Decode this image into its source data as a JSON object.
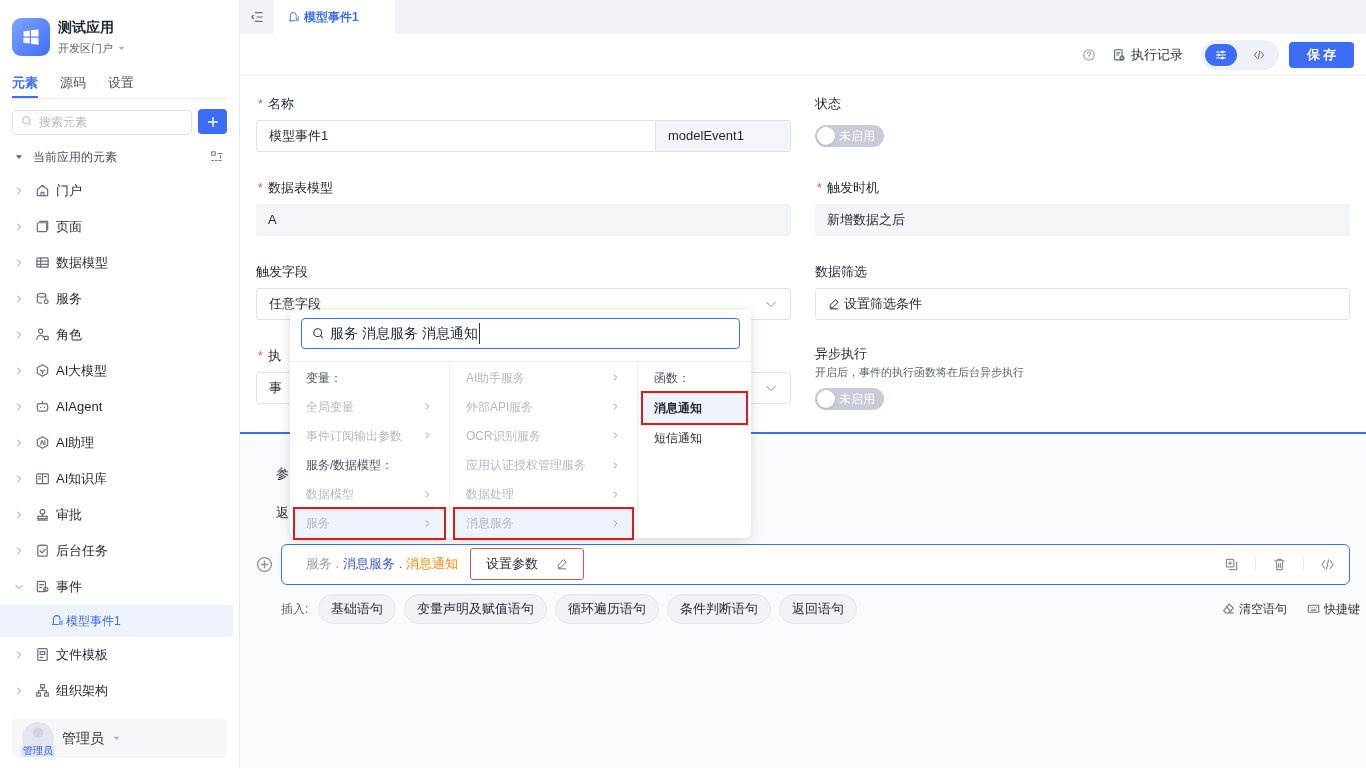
{
  "app": {
    "name": "测试应用",
    "portal": "开发区门户"
  },
  "sidebar": {
    "tabs": [
      {
        "label": "元素",
        "selected": true
      },
      {
        "label": "源码",
        "selected": false
      },
      {
        "label": "设置",
        "selected": false
      }
    ],
    "search": {
      "placeholder": "搜索元素"
    },
    "section_title": "当前应用的元素",
    "tree": [
      {
        "label": "门户",
        "expanded": false,
        "selected": false
      },
      {
        "label": "页面",
        "expanded": false,
        "selected": false
      },
      {
        "label": "数据模型",
        "expanded": false,
        "selected": false
      },
      {
        "label": "服务",
        "expanded": false,
        "selected": false
      },
      {
        "label": "角色",
        "expanded": false,
        "selected": false
      },
      {
        "label": "AI大模型",
        "expanded": false,
        "selected": false
      },
      {
        "label": "AIAgent",
        "expanded": false,
        "selected": false
      },
      {
        "label": "AI助理",
        "expanded": false,
        "selected": false
      },
      {
        "label": "AI知识库",
        "expanded": false,
        "selected": false
      },
      {
        "label": "审批",
        "expanded": false,
        "selected": false
      },
      {
        "label": "后台任务",
        "expanded": false,
        "selected": false
      },
      {
        "label": "事件",
        "expanded": true,
        "selected": false,
        "children": [
          {
            "label": "模型事件1",
            "selected": true
          }
        ]
      },
      {
        "label": "文件模板",
        "expanded": false,
        "selected": false
      },
      {
        "label": "组织架构",
        "expanded": false,
        "selected": false
      }
    ],
    "user": {
      "name": "管理员",
      "avatar_label": "管理员"
    }
  },
  "tabs": [
    {
      "label": "模型事件1",
      "selected": true
    }
  ],
  "toolbar": {
    "history": "执行记录",
    "modes": [
      {
        "selected": true
      },
      {
        "selected": false
      }
    ],
    "save": "保 存"
  },
  "form": {
    "required_mark": "*",
    "name": {
      "label": "名称",
      "required": true,
      "value": "模型事件1",
      "code": "modelEvent1"
    },
    "status": {
      "label": "状态",
      "on": false,
      "text": "未启用"
    },
    "model": {
      "label": "数据表模型",
      "required": true,
      "value": "A"
    },
    "trigger_time": {
      "label": "触发时机",
      "required": true,
      "value": "新增数据之后"
    },
    "trigger_field": {
      "label": "触发字段",
      "value": "任意字段"
    },
    "filter": {
      "label": "数据筛选",
      "value": "设置筛选条件"
    },
    "execute": {
      "label": "执",
      "required": true,
      "value": "事"
    },
    "async": {
      "label": "异步执行",
      "hint": "开启后，事件的执行函数将在后台异步执行",
      "on": false,
      "text": "未启用"
    }
  },
  "popup": {
    "search": "服务 消息服务 消息通知",
    "columns": [
      [
        {
          "kind": "heading",
          "label": "变量："
        },
        {
          "kind": "item",
          "label": "全局变量",
          "selected": false
        },
        {
          "kind": "item",
          "label": "事件订阅输出参数",
          "selected": false
        },
        {
          "kind": "heading",
          "label": "服务/数据模型："
        },
        {
          "kind": "item",
          "label": "数据模型",
          "selected": false
        },
        {
          "kind": "item",
          "label": "服务",
          "selected": true
        }
      ],
      [
        {
          "kind": "item",
          "label": "AI助手服务",
          "selected": false
        },
        {
          "kind": "item",
          "label": "外部API服务",
          "selected": false
        },
        {
          "kind": "item",
          "label": "OCR识别服务",
          "selected": false
        },
        {
          "kind": "item",
          "label": "应用认证授权管理服务",
          "selected": false
        },
        {
          "kind": "item",
          "label": "数据处理",
          "selected": false
        },
        {
          "kind": "item",
          "label": "消息服务",
          "selected": true
        }
      ],
      [
        {
          "kind": "heading",
          "label": "函数："
        },
        {
          "kind": "leaf",
          "label": "消息通知",
          "selected": true
        },
        {
          "kind": "leaf",
          "label": "短信通知",
          "selected": false
        }
      ]
    ]
  },
  "editor": {
    "labels": [
      "参",
      "返"
    ],
    "statement": [
      {
        "kind": "root",
        "text": "服务 ."
      },
      {
        "kind": "service",
        "text": "消息服务 ."
      },
      {
        "kind": "function",
        "text": "消息通知"
      }
    ],
    "set_params": "设置参数",
    "insert_label": "插入:",
    "insert": [
      "基础语句",
      "变量声明及赋值语句",
      "循环遍历语句",
      "条件判断语句",
      "返回语句"
    ],
    "clear": "清空语句",
    "shortcuts": "快捷键"
  }
}
